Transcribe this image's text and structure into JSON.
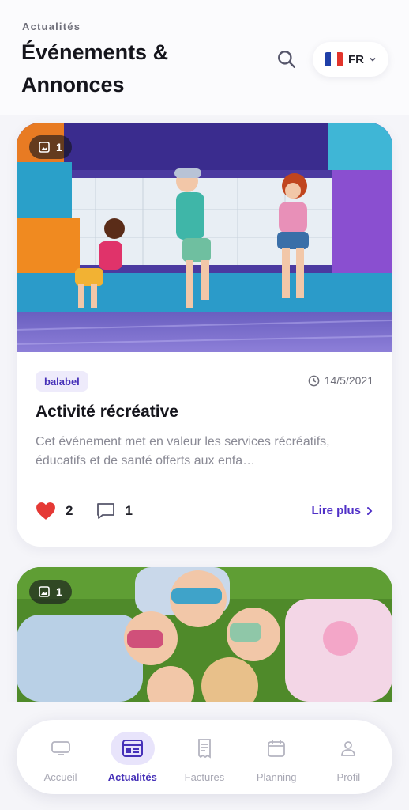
{
  "header": {
    "eyebrow": "Actualités",
    "title": "Événements & Annonces",
    "search_icon": "search-icon",
    "language": {
      "code": "FR",
      "flag_colors": [
        "#1f3fa8",
        "#ffffff",
        "#e2342b"
      ]
    }
  },
  "posts": [
    {
      "photo_count": "1",
      "tag": "balabel",
      "date": "14/5/2021",
      "title": "Activité récréative",
      "description": "Cet événement met en valeur les services récréatifs, éducatifs et de santé offerts aux enfa…",
      "likes": "2",
      "comments": "1",
      "read_more": "Lire plus"
    },
    {
      "photo_count": "1"
    }
  ],
  "nav": {
    "items": [
      {
        "label": "Accueil",
        "icon": "tv-icon",
        "active": false
      },
      {
        "label": "Actualités",
        "icon": "news-icon",
        "active": true
      },
      {
        "label": "Factures",
        "icon": "invoice-icon",
        "active": false
      },
      {
        "label": "Planning",
        "icon": "calendar-icon",
        "active": false
      },
      {
        "label": "Profil",
        "icon": "user-icon",
        "active": false
      }
    ]
  },
  "colors": {
    "accent": "#4631b8",
    "accent_soft": "#e8e4fb",
    "like_red": "#e53935",
    "background": "#f5f5f9"
  }
}
